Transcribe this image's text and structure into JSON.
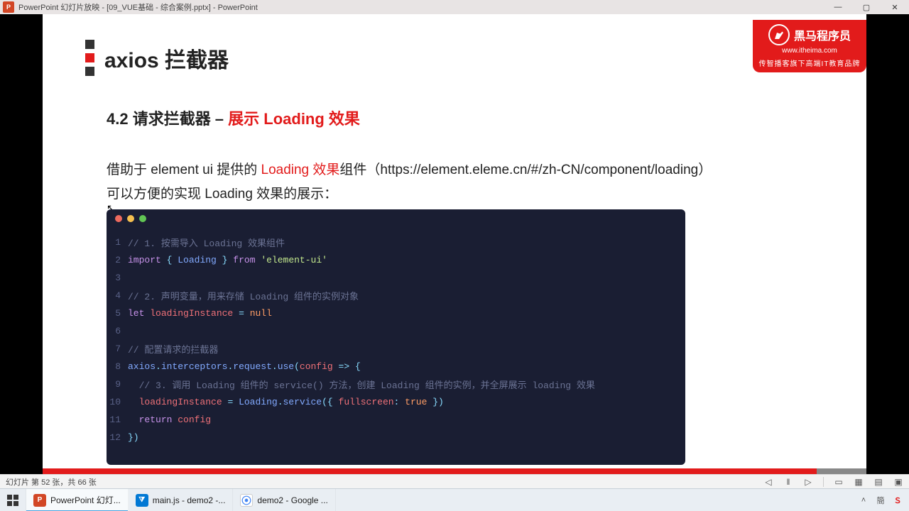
{
  "window": {
    "app_badge": "P",
    "title": "PowerPoint 幻灯片放映 - [09_VUE基础 - 综合案例.pptx] - PowerPoint",
    "controls": {
      "minimize": "—",
      "maximize": "▢",
      "close": "✕"
    }
  },
  "slide": {
    "title": "axios 拦截器",
    "logo": {
      "brand": "黑马程序员",
      "url": "www.itheima.com",
      "tagline": "传智播客旗下高端IT教育品牌"
    },
    "section_prefix": "4.2 请求拦截器 – ",
    "section_red": "展示 Loading 效果",
    "body_prefix": "借助于 element ui 提供的 ",
    "body_red": "Loading 效果",
    "body_suffix": "组件（https://element.eleme.cn/#/zh-CN/component/loading）",
    "body_line2": "可以方便的实现 Loading 效果的展示：",
    "code": {
      "lines": [
        {
          "n": "1",
          "segs": [
            {
              "c": "tk-comment",
              "t": "// 1. 按需导入 Loading 效果组件"
            }
          ]
        },
        {
          "n": "2",
          "segs": [
            {
              "c": "tk-keyword",
              "t": "import"
            },
            {
              "c": "tk-plain",
              "t": " "
            },
            {
              "c": "tk-punct",
              "t": "{"
            },
            {
              "c": "tk-plain",
              "t": " "
            },
            {
              "c": "tk-ident",
              "t": "Loading"
            },
            {
              "c": "tk-plain",
              "t": " "
            },
            {
              "c": "tk-punct",
              "t": "}"
            },
            {
              "c": "tk-plain",
              "t": " "
            },
            {
              "c": "tk-keyword",
              "t": "from"
            },
            {
              "c": "tk-plain",
              "t": " "
            },
            {
              "c": "tk-string",
              "t": "'element-ui'"
            }
          ]
        },
        {
          "n": "3",
          "segs": []
        },
        {
          "n": "4",
          "segs": [
            {
              "c": "tk-comment",
              "t": "// 2. 声明变量，用来存储 Loading 组件的实例对象"
            }
          ]
        },
        {
          "n": "5",
          "segs": [
            {
              "c": "tk-keyword",
              "t": "let"
            },
            {
              "c": "tk-plain",
              "t": " "
            },
            {
              "c": "tk-var",
              "t": "loadingInstance"
            },
            {
              "c": "tk-plain",
              "t": " "
            },
            {
              "c": "tk-punct",
              "t": "="
            },
            {
              "c": "tk-plain",
              "t": " "
            },
            {
              "c": "tk-const",
              "t": "null"
            }
          ]
        },
        {
          "n": "6",
          "segs": []
        },
        {
          "n": "7",
          "segs": [
            {
              "c": "tk-comment",
              "t": "// 配置请求的拦截器"
            }
          ]
        },
        {
          "n": "8",
          "segs": [
            {
              "c": "tk-ident",
              "t": "axios"
            },
            {
              "c": "tk-punct",
              "t": "."
            },
            {
              "c": "tk-ident",
              "t": "interceptors"
            },
            {
              "c": "tk-punct",
              "t": "."
            },
            {
              "c": "tk-ident",
              "t": "request"
            },
            {
              "c": "tk-punct",
              "t": "."
            },
            {
              "c": "tk-ident",
              "t": "use"
            },
            {
              "c": "tk-punct",
              "t": "("
            },
            {
              "c": "tk-var",
              "t": "config"
            },
            {
              "c": "tk-plain",
              "t": " "
            },
            {
              "c": "tk-punct",
              "t": "=>"
            },
            {
              "c": "tk-plain",
              "t": " "
            },
            {
              "c": "tk-punct",
              "t": "{"
            }
          ]
        },
        {
          "n": "9",
          "segs": [
            {
              "c": "tk-plain",
              "t": "  "
            },
            {
              "c": "tk-comment",
              "t": "// 3. 调用 Loading 组件的 service() 方法，创建 Loading 组件的实例，并全屏展示 loading 效果"
            }
          ]
        },
        {
          "n": "10",
          "segs": [
            {
              "c": "tk-plain",
              "t": "  "
            },
            {
              "c": "tk-var",
              "t": "loadingInstance"
            },
            {
              "c": "tk-plain",
              "t": " "
            },
            {
              "c": "tk-punct",
              "t": "="
            },
            {
              "c": "tk-plain",
              "t": " "
            },
            {
              "c": "tk-ident",
              "t": "Loading"
            },
            {
              "c": "tk-punct",
              "t": "."
            },
            {
              "c": "tk-ident",
              "t": "service"
            },
            {
              "c": "tk-punct",
              "t": "({"
            },
            {
              "c": "tk-plain",
              "t": " "
            },
            {
              "c": "tk-var",
              "t": "fullscreen"
            },
            {
              "c": "tk-punct",
              "t": ":"
            },
            {
              "c": "tk-plain",
              "t": " "
            },
            {
              "c": "tk-const",
              "t": "true"
            },
            {
              "c": "tk-plain",
              "t": " "
            },
            {
              "c": "tk-punct",
              "t": "})"
            }
          ]
        },
        {
          "n": "11",
          "segs": [
            {
              "c": "tk-plain",
              "t": "  "
            },
            {
              "c": "tk-keyword",
              "t": "return"
            },
            {
              "c": "tk-plain",
              "t": " "
            },
            {
              "c": "tk-var",
              "t": "config"
            }
          ]
        },
        {
          "n": "12",
          "segs": [
            {
              "c": "tk-punct",
              "t": "})"
            }
          ]
        }
      ]
    }
  },
  "status": {
    "text": "幻灯片 第 52 张，共 66 张"
  },
  "taskbar": {
    "powerpoint": "PowerPoint 幻灯...",
    "vscode": "main.js - demo2 -...",
    "chrome": "demo2 - Google ...",
    "tray_up": "˄",
    "tray_lang": "簡",
    "tray_ime": "Ｓ"
  }
}
